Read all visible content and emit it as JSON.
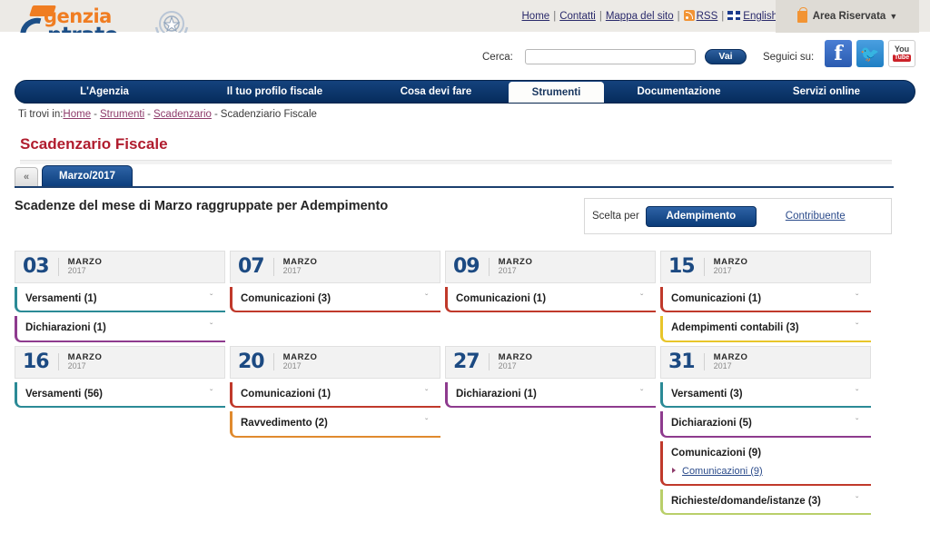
{
  "topbar": {
    "links": [
      "Home",
      "Contatti",
      "Mappa del sito",
      "RSS",
      "English"
    ],
    "rss_label": "RSS",
    "english_label": "English",
    "area_riservata": "Area Riservata",
    "caret": "▼"
  },
  "logo": {
    "word1": "genzia",
    "word2": "ntrate"
  },
  "search": {
    "label": "Cerca:",
    "value": "",
    "placeholder": "",
    "button": "Vai"
  },
  "social": {
    "label": "Seguici su:",
    "facebook": "f",
    "twitter": "🐦",
    "youtube_you": "You",
    "youtube_tube": "Tube"
  },
  "nav": {
    "items": [
      {
        "label": "L'Agenzia",
        "active": false
      },
      {
        "label": "Il tuo profilo fiscale",
        "active": false
      },
      {
        "label": "Cosa devi fare",
        "active": false
      },
      {
        "label": "Strumenti",
        "active": true
      },
      {
        "label": "Documentazione",
        "active": false
      },
      {
        "label": "Servizi online",
        "active": false
      }
    ]
  },
  "breadcrumb": {
    "prefix": "Ti trovi in:",
    "links": [
      "Home",
      "Strumenti",
      "Scadenzario"
    ],
    "current": "Scadenziario Fiscale",
    "dash": "-"
  },
  "page_title": "Scadenzario Fiscale",
  "monthbar": {
    "prev": "«",
    "month_tab": "Marzo/2017"
  },
  "section": {
    "title": "Scadenze del mese di Marzo raggruppate per Adempimento",
    "scelta_label": "Scelta per",
    "scelta_active": "Adempimento",
    "scelta_link": "Contribuente"
  },
  "colors": {
    "versamenti": "#2b8a96",
    "dichiarazioni": "#8e3b8e",
    "comunicazioni": "#c0392b",
    "adempimenti": "#e8c52a",
    "ravvedimento": "#e08a2e",
    "richieste": "#b9cf6a",
    "title": "#b01c2e",
    "nav": "#0d3f7d"
  },
  "chevron": "ˇ",
  "days": [
    {
      "day": "03",
      "month": "MARZO",
      "year": "2017",
      "items": [
        {
          "label": "Versamenti (1)",
          "cls": "c-versamenti",
          "expanded": false
        },
        {
          "label": "Dichiarazioni (1)",
          "cls": "c-dichiarazioni",
          "expanded": false
        }
      ]
    },
    {
      "day": "07",
      "month": "MARZO",
      "year": "2017",
      "items": [
        {
          "label": "Comunicazioni (3)",
          "cls": "c-comunicazioni",
          "expanded": false
        }
      ]
    },
    {
      "day": "09",
      "month": "MARZO",
      "year": "2017",
      "items": [
        {
          "label": "Comunicazioni (1)",
          "cls": "c-comunicazioni",
          "expanded": false
        }
      ]
    },
    {
      "day": "15",
      "month": "MARZO",
      "year": "2017",
      "items": [
        {
          "label": "Comunicazioni (1)",
          "cls": "c-comunicazioni",
          "expanded": false
        },
        {
          "label": "Adempimenti contabili (3)",
          "cls": "c-adempimenti",
          "expanded": false
        }
      ]
    },
    {
      "day": "16",
      "month": "MARZO",
      "year": "2017",
      "items": [
        {
          "label": "Versamenti (56)",
          "cls": "c-versamenti",
          "expanded": false
        }
      ]
    },
    {
      "day": "20",
      "month": "MARZO",
      "year": "2017",
      "items": [
        {
          "label": "Comunicazioni (1)",
          "cls": "c-comunicazioni",
          "expanded": false
        },
        {
          "label": "Ravvedimento (2)",
          "cls": "c-ravvedimento",
          "expanded": false
        }
      ]
    },
    {
      "day": "27",
      "month": "MARZO",
      "year": "2017",
      "items": [
        {
          "label": "Dichiarazioni (1)",
          "cls": "c-dichiarazioni",
          "expanded": false
        }
      ]
    },
    {
      "day": "31",
      "month": "MARZO",
      "year": "2017",
      "items": [
        {
          "label": "Versamenti (3)",
          "cls": "c-versamenti",
          "expanded": false
        },
        {
          "label": "Dichiarazioni (5)",
          "cls": "c-dichiarazioni",
          "expanded": false
        },
        {
          "label": "Comunicazioni (9)",
          "cls": "c-comunicazioni",
          "expanded": true,
          "sublinks": [
            "Comunicazioni (9)"
          ]
        },
        {
          "label": "Richieste/domande/istanze (3)",
          "cls": "c-richieste",
          "expanded": false
        }
      ]
    }
  ]
}
